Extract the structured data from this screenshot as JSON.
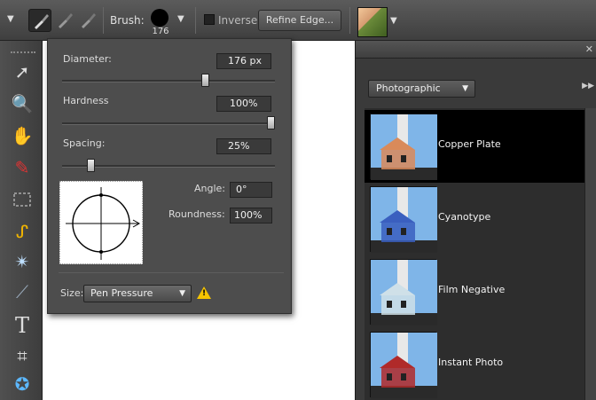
{
  "options_bar": {
    "brush_label": "Brush:",
    "brush_size": "176",
    "inverse_label": "Inverse",
    "refine_edge_label": "Refine Edge..."
  },
  "brush_popup": {
    "diameter_label": "Diameter:",
    "diameter_value": "176 px",
    "diameter_fraction": 0.68,
    "hardness_label": "Hardness",
    "hardness_value": "100%",
    "hardness_fraction": 1.0,
    "spacing_label": "Spacing:",
    "spacing_value": "25%",
    "spacing_fraction": 0.12,
    "angle_label": "Angle:",
    "angle_value": "0°",
    "roundness_label": "Roundness:",
    "roundness_value": "100%",
    "size_label": "Size:",
    "size_option": "Pen Pressure"
  },
  "filter_panel": {
    "category": "Photographic",
    "items": [
      {
        "label": "Copper Plate",
        "selected": true,
        "tint": "#d98a5a"
      },
      {
        "label": "Cyanotype",
        "selected": false,
        "tint": "#3a5fbf"
      },
      {
        "label": "Film Negative",
        "selected": false,
        "tint": "#cfe0e8"
      },
      {
        "label": "Instant Photo",
        "selected": false,
        "tint": "#b02a2a"
      }
    ]
  },
  "colors": {
    "accent_warning": "#f5c400",
    "selected_row": "#000000"
  }
}
